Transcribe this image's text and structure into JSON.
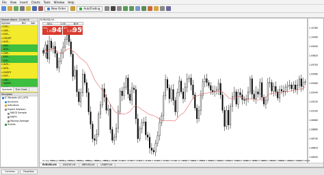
{
  "menu": [
    "File",
    "View",
    "Insert",
    "Charts",
    "Tools",
    "Window",
    "Help"
  ],
  "toolbar": {
    "new_order": "New Order",
    "autotrading": "AutoTrading"
  },
  "market_watch": {
    "title": "Market Watch: 23:06:59",
    "columns": [
      "Symbol",
      "Bid",
      "Ask"
    ],
    "rows": [
      {
        "symbol": "USD...",
        "state": "down"
      },
      {
        "symbol": "GBP...",
        "state": "down"
      },
      {
        "symbol": "EUR...",
        "state": "down"
      },
      {
        "symbol": "USDJPY",
        "state": "down"
      },
      {
        "symbol": "AUD...",
        "state": "down"
      },
      {
        "symbol": "EUR...",
        "state": "up"
      },
      {
        "symbol": "AUD...",
        "state": "up"
      },
      {
        "symbol": "GBP...",
        "state": "down"
      },
      {
        "symbol": "EUR...",
        "state": "up"
      },
      {
        "symbol": "EUR...",
        "state": "up"
      },
      {
        "symbol": "AUD...",
        "state": "down"
      },
      {
        "symbol": "NZD...",
        "state": "down"
      },
      {
        "symbol": "EURJPY",
        "state": "down"
      },
      {
        "symbol": "EUR...",
        "state": "down"
      },
      {
        "symbol": "CAD...",
        "state": "up"
      },
      {
        "symbol": "GBPJPY",
        "state": "up"
      },
      {
        "symbol": "EUR...",
        "state": "up"
      },
      {
        "symbol": "AUD...",
        "state": "down"
      }
    ],
    "tabs": [
      "Symbols",
      "Tick Chart"
    ]
  },
  "navigator": {
    "title": "Navigator",
    "items": [
      {
        "label": "IC Markets (SC) MT4",
        "level": 0,
        "color": "#2e7bd6"
      },
      {
        "label": "Accounts",
        "level": 1,
        "color": "#4a90d9"
      },
      {
        "label": "Indicators",
        "level": 1,
        "color": "#e0a020"
      },
      {
        "label": "Expert Advisors",
        "level": 1,
        "color": "#8a8a8a"
      },
      {
        "label": "MACD Sample",
        "level": 2,
        "color": "#8a8a8a"
      },
      {
        "label": "MAPO",
        "level": 2,
        "color": "#8a8a8a"
      },
      {
        "label": "Moving Average",
        "level": 2,
        "color": "#8a8a8a"
      },
      {
        "label": "Scripts",
        "level": 1,
        "color": "#3a9a3a"
      }
    ]
  },
  "bottom_tabs": [
    "Common",
    "Favorites"
  ],
  "chart": {
    "title": "EURUSD,H4",
    "tabs": [
      "EURUSD,H4",
      "USDCHF,H4",
      "GBPUSD,H4",
      "USDJPY,H4"
    ],
    "one_click": {
      "sell_label": "SELL",
      "buy_label": "BUY",
      "lot": "1.00",
      "sell_pre": "1.09",
      "sell_big": "94",
      "sell_sup": "8",
      "buy_pre": "1.09",
      "buy_big": "95",
      "buy_sup": "0"
    },
    "candle_color": "#000000",
    "ma_color": "#e06060"
  },
  "chart_data": {
    "type": "candlestick",
    "ylim": [
      1.085,
      1.1025
    ],
    "y_ticks": [
      "1.10180",
      "1.10060",
      "1.09940",
      "1.09820",
      "1.09700",
      "1.09580",
      "1.09460",
      "1.09340",
      "1.09220",
      "1.09100",
      "1.08980",
      "1.08860",
      "1.08740",
      "1.08620",
      "1.08500"
    ],
    "x_ticks": [
      "21 Sep 2015",
      "22 Sep 08:00",
      "23 Sep 08:00",
      "24 Sep 08:00",
      "25 Sep 08:00",
      "28 Sep 08:00",
      "29 Sep 08:00",
      "30 Sep 08:00",
      "1 Oct 08:00",
      "2 Oct 08:00",
      "5 Oct 08:00",
      "6 Oct 08:00",
      "7 Oct 08:00",
      "8 Oct 08:00",
      "9 Oct 08:00",
      "12 Oct 08:00",
      "13 Oct 08:00",
      "14 Oct 08:00",
      "15 Oct 08:00",
      "16 Oct 08:00",
      "19 Oct 08:00",
      "20 Oct 08:00",
      "21 Oct 08:00",
      "22 Oct 08:00",
      "23 Oct 08:00",
      "26 Oct 08:00",
      "27 Oct 08:00",
      "28 Oct 08:00",
      "29 Oct 08:00",
      "30 Oct 08:00"
    ],
    "close": [
      1.0985,
      1.0996,
      1.0978,
      1.1001,
      1.0992,
      1.0994,
      1.0985,
      1.0966,
      1.0975,
      1.0985,
      1.0993,
      1.1003,
      1.1018,
      1.1,
      1.0984,
      1.0955,
      1.0963,
      1.0935,
      1.0922,
      1.0934,
      1.0958,
      1.0947,
      1.0934,
      1.0909,
      1.0893,
      1.0874,
      1.0872,
      1.088,
      1.0906,
      1.0918,
      1.0939,
      1.0928,
      1.0911,
      1.0913,
      1.0886,
      1.0872,
      1.0876,
      1.0888,
      1.091,
      1.0936,
      1.093,
      1.0941,
      1.0953,
      1.0932,
      1.0924,
      1.094,
      1.0938,
      1.09,
      1.0874,
      1.0887,
      1.0895,
      1.0896,
      1.0879,
      1.0876,
      1.0862,
      1.0859,
      1.0857,
      1.0868,
      1.0878,
      1.0895,
      1.0904,
      1.093,
      1.0951,
      1.094,
      1.0926,
      1.0938,
      1.0924,
      1.0909,
      1.0934,
      1.0949,
      1.0935,
      1.0926,
      1.0941,
      1.0952,
      1.0953,
      1.0944,
      1.0931,
      1.0914,
      1.09,
      1.0911,
      1.093,
      1.0948,
      1.0952,
      1.0947,
      1.0943,
      1.0937,
      1.0935,
      1.0936,
      1.0938,
      1.0946,
      1.0931,
      1.0911,
      1.089,
      1.0911,
      1.0892,
      1.0916,
      1.0929,
      1.0935,
      1.0919,
      1.0934,
      1.0931,
      1.0925,
      1.0924,
      1.0926,
      1.0935,
      1.0952,
      1.0932,
      1.0926,
      1.0935,
      1.0932,
      1.0947,
      1.0928,
      1.0919,
      1.0924,
      1.0947,
      1.0947,
      1.0936,
      1.0942,
      1.0935,
      1.0927,
      1.0938,
      1.0936,
      1.0935,
      1.0941,
      1.0943,
      1.0944,
      1.0939,
      1.0944,
      1.0938,
      1.0944,
      1.0952,
      1.0942,
      1.0947,
      1.0948
    ]
  }
}
